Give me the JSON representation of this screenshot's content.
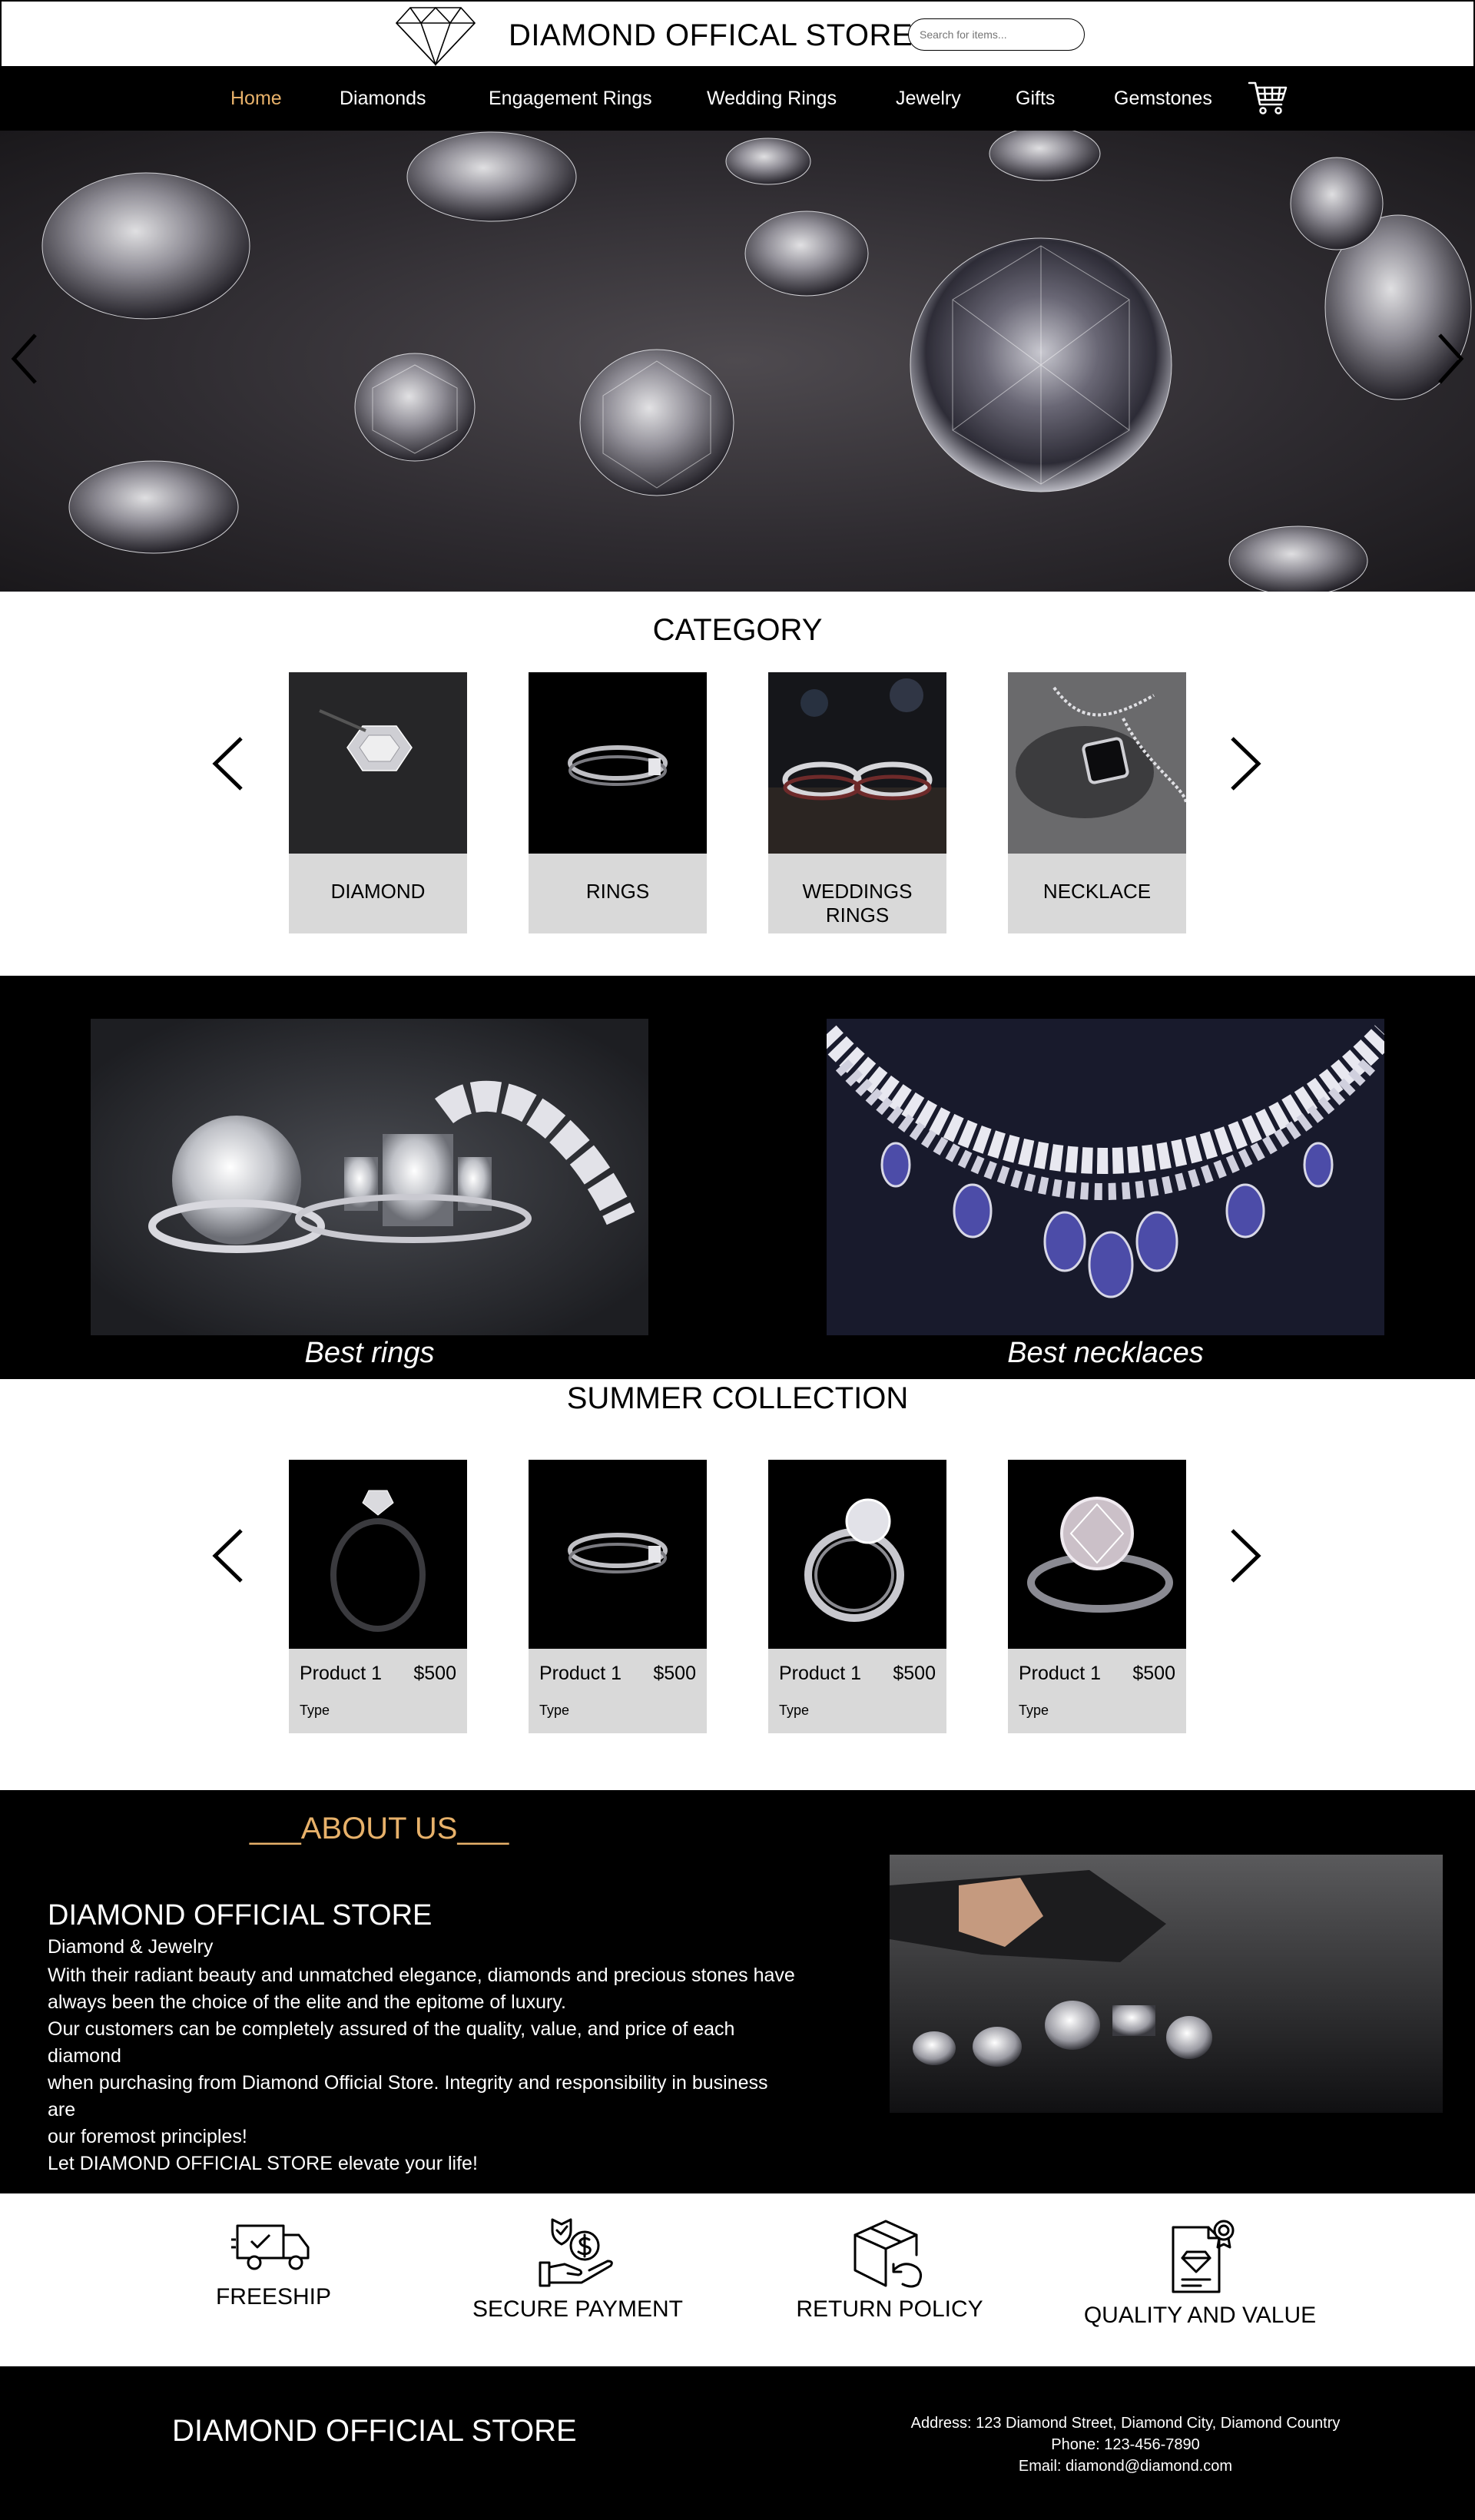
{
  "header": {
    "title": "DIAMOND OFFICAL STORE",
    "search_placeholder": "Search for items..."
  },
  "nav": {
    "items": [
      {
        "label": "Home",
        "active": true
      },
      {
        "label": "Diamonds"
      },
      {
        "label": "Engagement Rings"
      },
      {
        "label": "Wedding Rings"
      },
      {
        "label": "Jewelry"
      },
      {
        "label": "Gifts"
      },
      {
        "label": "Gemstones"
      }
    ],
    "active_color": "#e7b16a"
  },
  "category": {
    "title": "CATEGORY",
    "items": [
      {
        "label": "DIAMOND"
      },
      {
        "label": "RINGS"
      },
      {
        "label": "WEDDINGS RINGS"
      },
      {
        "label": "NECKLACE"
      }
    ]
  },
  "best": {
    "rings": "Best rings",
    "necklaces": "Best necklaces"
  },
  "summer": {
    "title": "SUMMER COLLECTION",
    "products": [
      {
        "name": "Product 1",
        "price": "$500",
        "type": "Type"
      },
      {
        "name": "Product 1",
        "price": "$500",
        "type": "Type"
      },
      {
        "name": "Product 1",
        "price": "$500",
        "type": "Type"
      },
      {
        "name": "Product 1",
        "price": "$500",
        "type": "Type"
      }
    ]
  },
  "about": {
    "title": "___ABOUT US___",
    "store": "DIAMOND OFFICIAL STORE",
    "subtitle": "Diamond & Jewelry",
    "text": "With their radiant beauty and unmatched elegance, diamonds and precious stones have\nalways been the choice of the elite and the epitome of luxury.\nOur customers can be completely assured of the quality, value, and price of each diamond\nwhen purchasing from Diamond Official Store. Integrity and responsibility in business are\nour foremost principles!\nLet DIAMOND OFFICIAL STORE elevate your life!",
    "accent_color": "#e7b16a"
  },
  "features": [
    {
      "label": "FREESHIP",
      "icon": "delivery-truck-icon"
    },
    {
      "label": "SECURE PAYMENT",
      "icon": "secure-payment-icon"
    },
    {
      "label": "RETURN POLICY",
      "icon": "return-box-icon"
    },
    {
      "label": "QUALITY AND VALUE",
      "icon": "certificate-icon"
    }
  ],
  "footer": {
    "store": "DIAMOND OFFICIAL STORE",
    "address": "Address: 123 Diamond Street, Diamond City, Diamond Country",
    "phone": "Phone: 123-456-7890",
    "email": "Email: diamond@diamond.com"
  }
}
